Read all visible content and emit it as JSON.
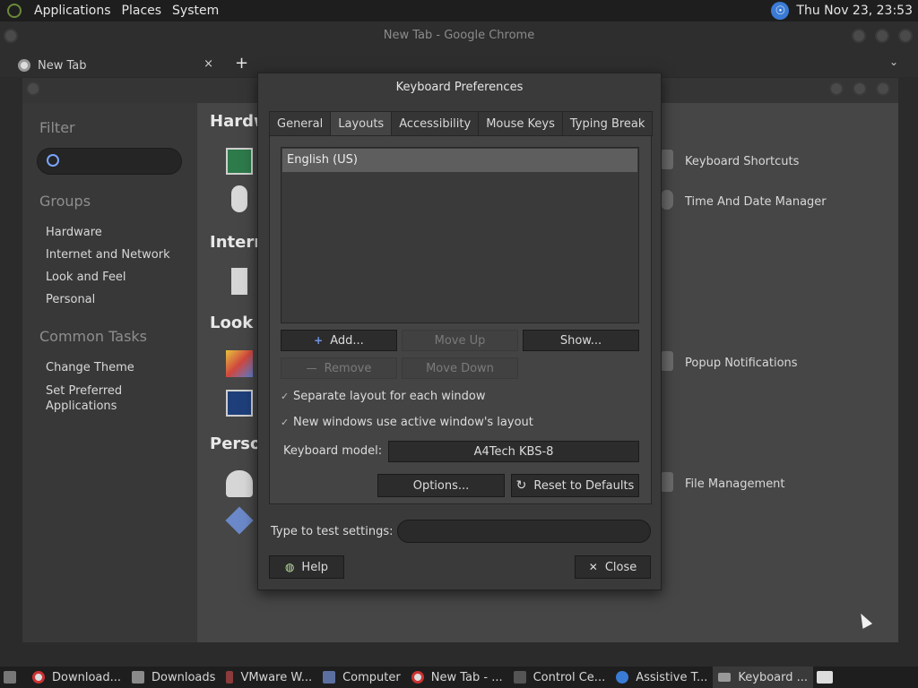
{
  "top_panel": {
    "menus": [
      "Applications",
      "Places",
      "System"
    ],
    "clock": "Thu Nov 23, 23:53"
  },
  "chrome": {
    "window_title": "New Tab - Google Chrome",
    "tab_label": "New Tab",
    "tab_close": "×",
    "new_tab": "+",
    "tab_menu": "⌄"
  },
  "control_center": {
    "sidebar": {
      "filter_heading": "Filter",
      "groups_heading": "Groups",
      "groups": [
        "Hardware",
        "Internet and Network",
        "Look and Feel",
        "Personal"
      ],
      "tasks_heading": "Common Tasks",
      "tasks": [
        "Change Theme",
        "Set Preferred Applications"
      ]
    },
    "main": {
      "headings": [
        "Hardw",
        "Intern",
        "Look a",
        "Perso"
      ],
      "right_items": [
        "Keyboard Shortcuts",
        "Time And Date Manager",
        "Popup Notifications",
        "File Management"
      ]
    }
  },
  "keyboard_dialog": {
    "title": "Keyboard Preferences",
    "tabs": [
      "General",
      "Layouts",
      "Accessibility",
      "Mouse Keys",
      "Typing Break"
    ],
    "active_tab": "Layouts",
    "layouts": [
      "English (US)"
    ],
    "buttons": {
      "add": "Add...",
      "move_up": "Move Up",
      "show": "Show...",
      "remove": "Remove",
      "move_down": "Move Down",
      "options": "Options...",
      "reset": "Reset to Defaults",
      "help": "Help",
      "close": "Close"
    },
    "checks": {
      "separate_layout": "Separate layout for each window",
      "new_windows": "New windows use active window's layout"
    },
    "model_label": "Keyboard model:",
    "model_value": "A4Tech KBS-8",
    "test_label": "Type to test settings:",
    "test_value": ""
  },
  "taskbar": {
    "items": [
      "Download...",
      "Downloads",
      "VMware W...",
      "Computer",
      "New Tab - ...",
      "Control Ce...",
      "Assistive T...",
      "Keyboard ..."
    ]
  }
}
